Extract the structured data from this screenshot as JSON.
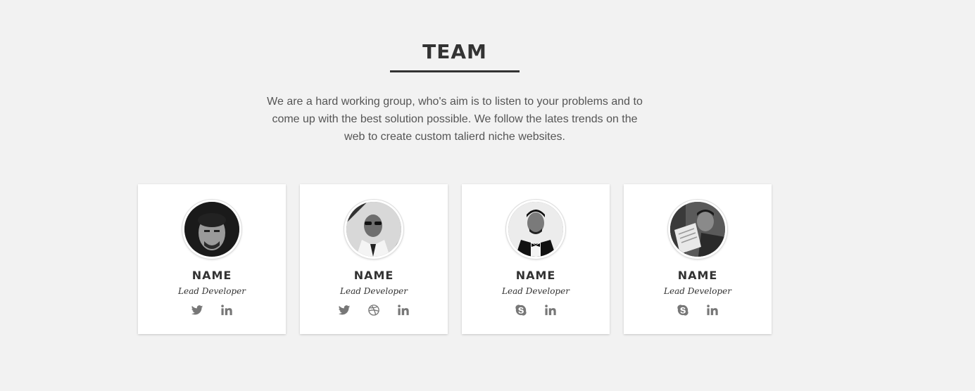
{
  "section": {
    "title": "TEAM",
    "intro": "We are a hard working group, who's aim is to listen to your problems and to come up with the best solution possible. We follow the lates trends on the web to create custom talierd niche websites."
  },
  "members": [
    {
      "name": "NAME",
      "role": "Lead Developer",
      "socials": [
        "twitter-icon",
        "linkedin-icon"
      ]
    },
    {
      "name": "NAME",
      "role": "Lead Developer",
      "socials": [
        "twitter-icon",
        "dribbble-icon",
        "linkedin-icon"
      ]
    },
    {
      "name": "NAME",
      "role": "Lead Developer",
      "socials": [
        "skype-icon",
        "linkedin-icon"
      ]
    },
    {
      "name": "NAME",
      "role": "Lead Developer",
      "socials": [
        "skype-icon",
        "linkedin-icon"
      ]
    }
  ],
  "colors": {
    "background": "#f2f2f2",
    "card": "#ffffff",
    "text": "#333333",
    "icon": "#777777"
  }
}
